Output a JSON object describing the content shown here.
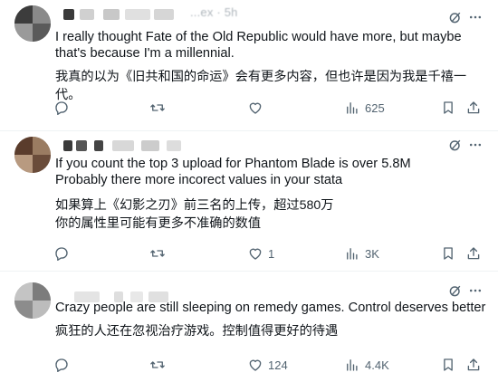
{
  "posts": [
    {
      "handle_fragment": "...ex · 5h",
      "text": "I really thought Fate of the Old Republic would have more, but maybe that's because I'm a millennial.",
      "translation": "我真的以为《旧共和国的命运》会有更多内容，但也许是因为我是千禧一代。",
      "reply_count": "",
      "repost_count": "",
      "like_count": "",
      "views_count": "625"
    },
    {
      "handle_fragment": "",
      "text": "If you count the top 3 upload for Phantom Blade is over 5.8M\nProbably there more incorect values in your stata",
      "translation": "如果算上《幻影之刃》前三名的上传，超过580万\n你的属性里可能有更多不准确的数值",
      "reply_count": "",
      "repost_count": "",
      "like_count": "1",
      "views_count": "3K"
    },
    {
      "handle_fragment": "",
      "text": "Crazy people are still sleeping on remedy games. Control deserves better",
      "translation": "疯狂的人还在忽视治疗游戏。控制值得更好的待遇",
      "reply_count": "",
      "repost_count": "",
      "like_count": "124",
      "views_count": "4.4K"
    }
  ],
  "icons": {
    "grok": "grok-icon",
    "more": "more-icon",
    "reply": "reply-icon",
    "repost": "repost-icon",
    "like": "like-icon",
    "views": "views-icon",
    "bookmark": "bookmark-icon",
    "share": "share-icon"
  },
  "colors": {
    "text": "#0f1419",
    "muted": "#536471",
    "divider": "#eff3f4"
  }
}
